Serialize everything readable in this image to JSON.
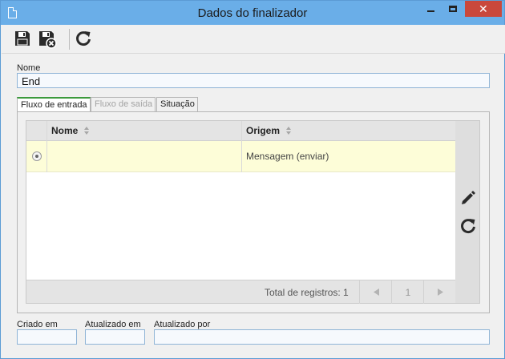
{
  "window": {
    "title": "Dados do finalizador"
  },
  "icons": {
    "app": "document-icon",
    "save": "save-icon",
    "save_close": "save-and-close-icon",
    "refresh": "refresh-icon",
    "edit": "pencil-icon",
    "grid_refresh": "refresh-icon",
    "sort": "sort-icon",
    "first": "triangle-left-icon",
    "next": "triangle-right-icon"
  },
  "form": {
    "nome_label": "Nome",
    "nome_value": "End"
  },
  "tabs": [
    {
      "label": "Fluxo de entrada",
      "state": "active"
    },
    {
      "label": "Fluxo de saída",
      "state": "disabled"
    },
    {
      "label": "Situação",
      "state": "normal"
    }
  ],
  "grid": {
    "columns": [
      "Nome",
      "Origem"
    ],
    "rows": [
      {
        "nome": "",
        "origem": "Mensagem (enviar)",
        "selected": true
      }
    ],
    "total_text": "Total de registros: 1",
    "page": "1"
  },
  "footer": {
    "criado_label": "Criado em",
    "criado_value": "",
    "atualizado_label": "Atualizado em",
    "atualizado_value": "",
    "atualizado_por_label": "Atualizado por",
    "atualizado_por_value": ""
  },
  "colors": {
    "titlebar": "#6aaee8",
    "close_button": "#c9483c",
    "active_tab_accent": "#3c9a3c",
    "selected_row": "#fdfdd8"
  }
}
